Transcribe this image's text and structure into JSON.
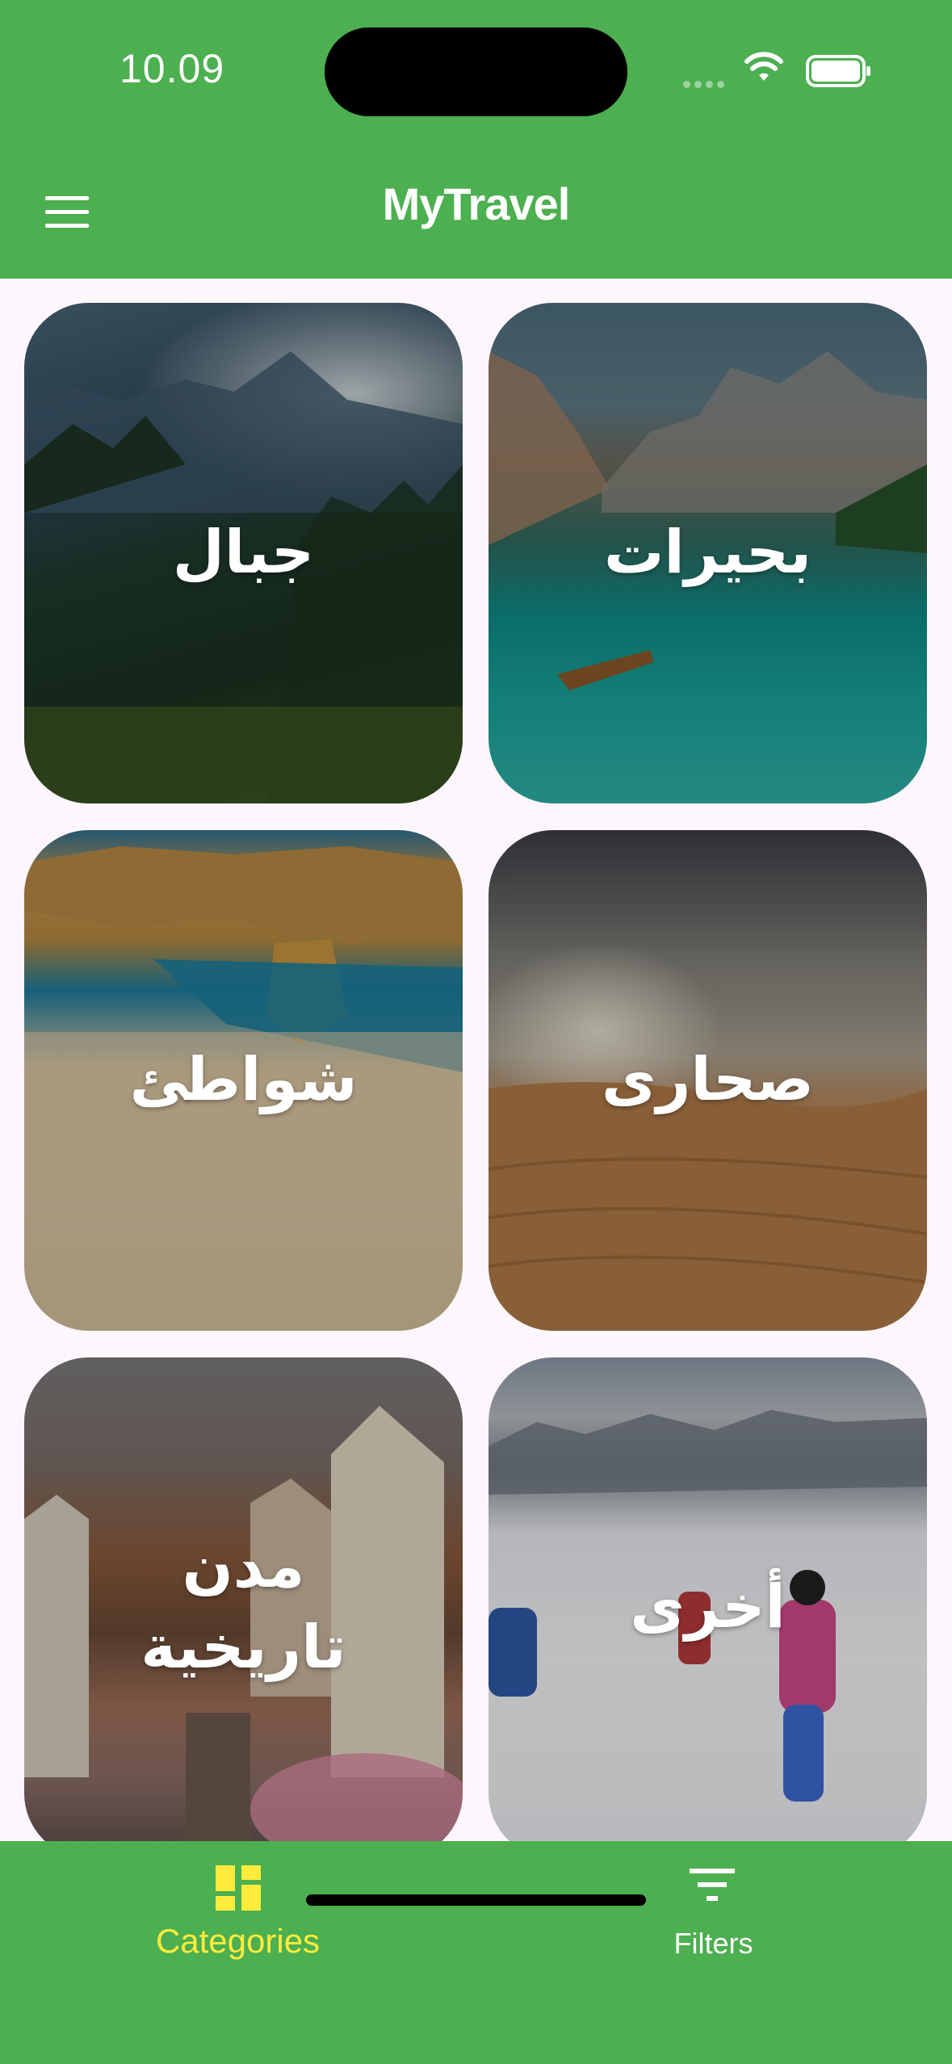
{
  "status_bar": {
    "time": "10.09"
  },
  "app_bar": {
    "title": "MyTravel"
  },
  "categories": [
    {
      "label": "جبال"
    },
    {
      "label": "بحيرات"
    },
    {
      "label": "شواطئ"
    },
    {
      "label": "صحارى"
    },
    {
      "label": "مدن تاريخية"
    },
    {
      "label": "أخرى"
    }
  ],
  "bottom_nav": {
    "items": [
      {
        "label": "Categories",
        "active": true
      },
      {
        "label": "Filters",
        "active": false
      }
    ]
  },
  "colors": {
    "primary": "#4caf50",
    "active_tab": "#ffeb3b",
    "background": "#fdf7fd"
  }
}
